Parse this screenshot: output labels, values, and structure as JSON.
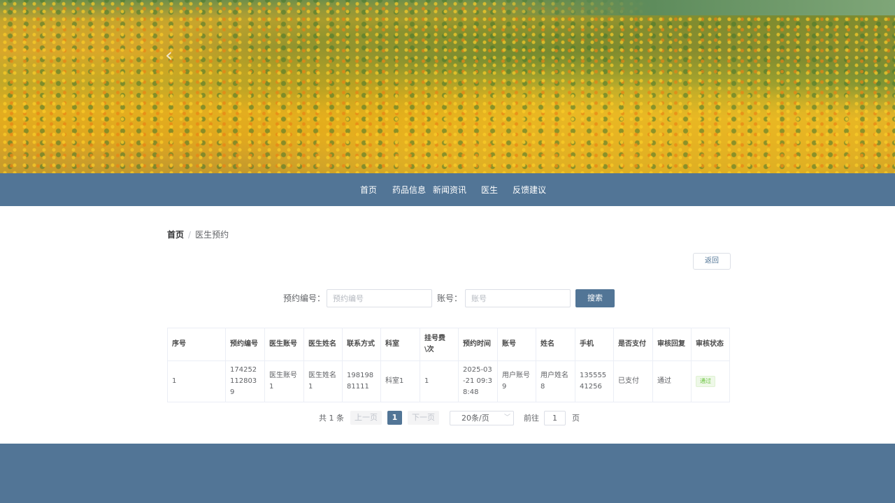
{
  "nav": {
    "items": [
      {
        "label": "首页"
      },
      {
        "label": "药品信息"
      },
      {
        "label": "新闻资讯"
      },
      {
        "label": "医生"
      },
      {
        "label": "反馈建议"
      }
    ]
  },
  "breadcrumb": {
    "home": "首页",
    "separator": "/",
    "current": "医生预约"
  },
  "back_button": "返回",
  "search": {
    "appointment_no_label": "预约编号：",
    "appointment_no_placeholder": "预约编号",
    "account_label": "账号：",
    "account_placeholder": "账号",
    "button": "搜索"
  },
  "table": {
    "headers": [
      "序号",
      "预约编号",
      "医生账号",
      "医生姓名",
      "联系方式",
      "科室",
      "挂号费\\次",
      "预约时间",
      "账号",
      "姓名",
      "手机",
      "是否支付",
      "审核回复",
      "审核状态"
    ],
    "rows": [
      {
        "index": "1",
        "appointment_no": "1742521128039",
        "doctor_account": "医生账号1",
        "doctor_name": "医生姓名1",
        "contact": "19819881111",
        "department": "科室1",
        "fee": "1",
        "appointment_time": "2025-03-21 09:38:48",
        "account": "用户账号9",
        "name": "用户姓名8",
        "phone": "13555541256",
        "paid": "已支付",
        "review_reply": "通过",
        "review_status": "通过"
      }
    ]
  },
  "pagination": {
    "total": "共 1 条",
    "prev": "上一页",
    "current_page": "1",
    "next": "下一页",
    "page_size": "20条/页",
    "goto_label": "前往",
    "goto_value": "1",
    "goto_unit": "页"
  },
  "colors": {
    "primary": "#527596",
    "success": "#67c23a"
  }
}
